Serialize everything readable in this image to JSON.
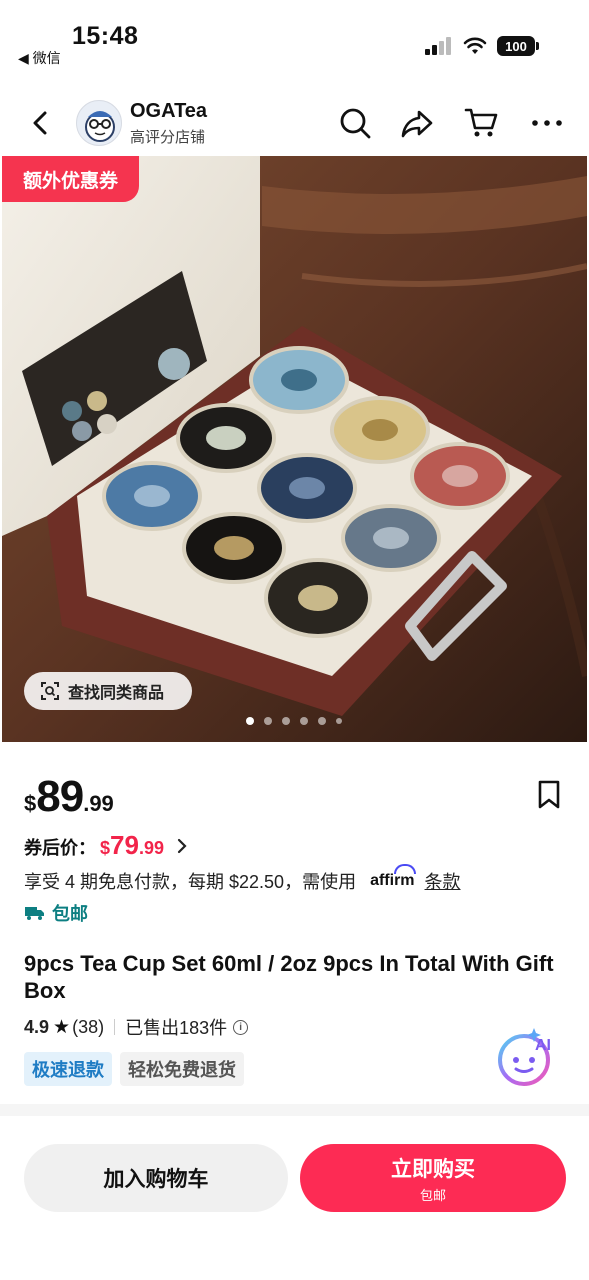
{
  "status_bar": {
    "time": "15:48",
    "back_app": "◀ 微信",
    "battery": "100"
  },
  "nav": {
    "shop_name": "OGATea",
    "shop_subtitle": "高评分店铺",
    "icons": [
      "back-icon",
      "search-icon",
      "share-icon",
      "cart-icon",
      "more-icon"
    ]
  },
  "hero": {
    "coupon_badge": "额外优惠券",
    "find_similar": "查找同类商品",
    "image_count": 6,
    "active_index": 0
  },
  "price": {
    "currency": "$",
    "integer": "89",
    "decimal": ".99",
    "after_coupon_label": "券后价：",
    "after_coupon_currency": "$",
    "after_coupon_integer": "79",
    "after_coupon_decimal": ".99"
  },
  "installment": {
    "text": "享受 4 期免息付款，每期 $22.50，需使用",
    "provider": "affirm",
    "terms": "条款"
  },
  "shipping": {
    "label": "包邮"
  },
  "product": {
    "title": "9pcs Tea Cup Set 60ml / 2oz 9pcs In Total With Gift Box",
    "rating": "4.9",
    "reviews": "(38)",
    "sold": "已售出183件"
  },
  "tags": [
    "极速退款",
    "轻松免费退货"
  ],
  "ai_label": "AI",
  "bottom": {
    "add_to_cart": "加入购物车",
    "buy_now": "立即购买",
    "buy_now_sub": "包邮"
  },
  "colors": {
    "accent_red": "#fd2b54",
    "price_red": "#f2244a",
    "shipping_teal": "#0d7f82",
    "tag_blue": "#1f7cc4"
  }
}
